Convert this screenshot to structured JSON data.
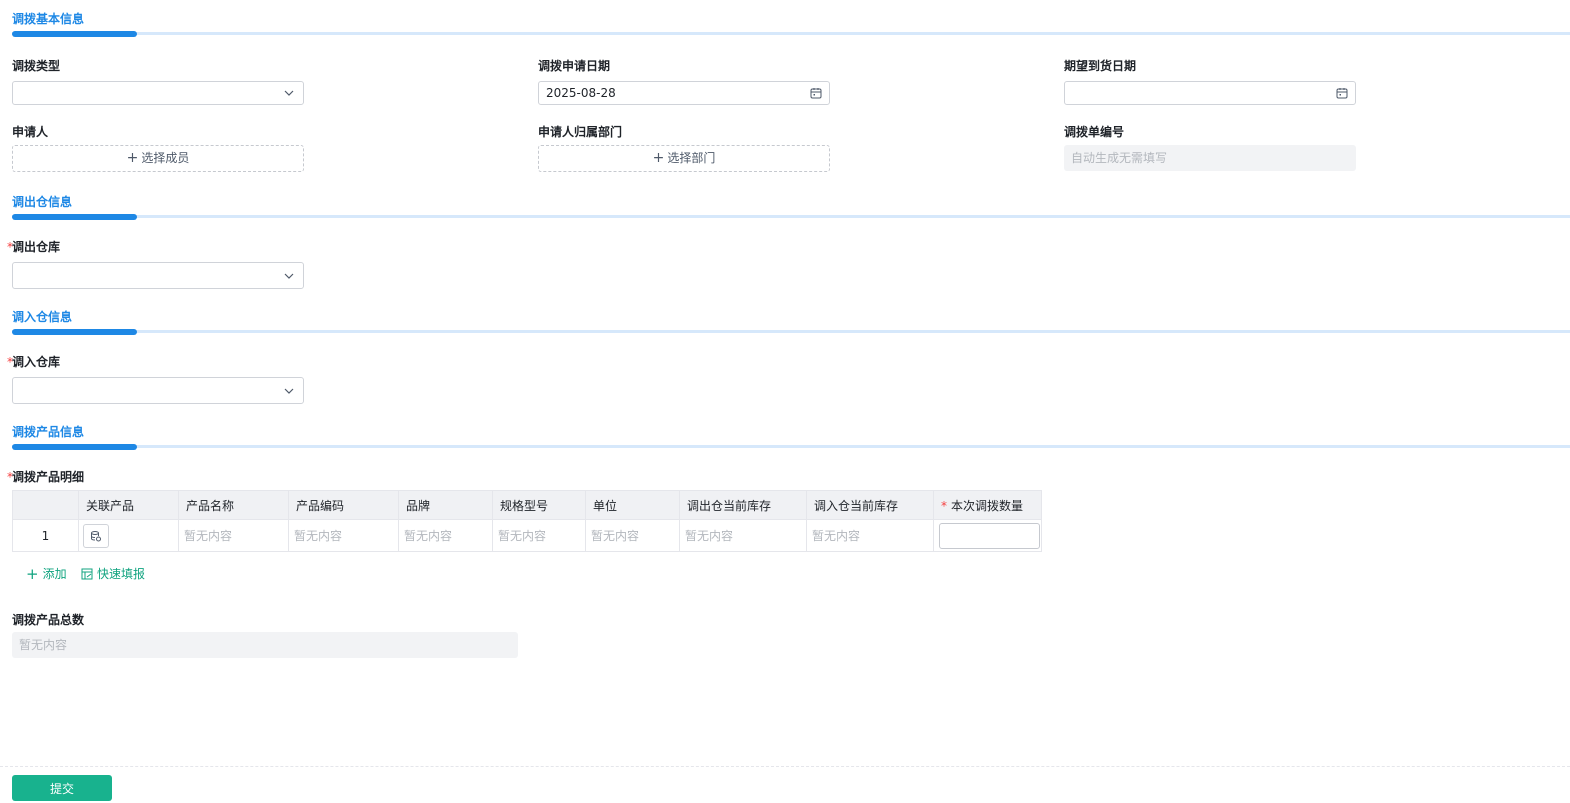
{
  "sections": {
    "basic": "调拨基本信息",
    "out": "调出仓信息",
    "in": "调入仓信息",
    "product": "调拨产品信息"
  },
  "basic": {
    "type_label": "调拨类型",
    "type_value": "",
    "apply_date_label": "调拨申请日期",
    "apply_date_value": "2025-08-28",
    "expect_date_label": "期望到货日期",
    "expect_date_value": "",
    "applicant_label": "申请人",
    "applicant_button": "选择成员",
    "dept_label": "申请人归属部门",
    "dept_button": "选择部门",
    "order_no_label": "调拨单编号",
    "order_no_placeholder": "自动生成无需填写"
  },
  "out": {
    "warehouse_label": "调出仓库",
    "required_mark": "*"
  },
  "in": {
    "warehouse_label": "调入仓库",
    "required_mark": "*"
  },
  "product": {
    "detail_label": "调拨产品明细",
    "required_mark": "*",
    "columns": [
      "",
      "关联产品",
      "产品名称",
      "产品编码",
      "品牌",
      "规格型号",
      "单位",
      "调出仓当前库存",
      "调入仓当前库存",
      "本次调拨数量"
    ],
    "qty_required_mark": "*",
    "rows": [
      {
        "index": "1",
        "name": "暂无内容",
        "code": "暂无内容",
        "brand": "暂无内容",
        "spec": "暂无内容",
        "unit": "暂无内容",
        "out_stock": "暂无内容",
        "in_stock": "暂无内容"
      }
    ],
    "add_label": "添加",
    "quick_fill_label": "快速填报",
    "total_label": "调拨产品总数",
    "total_value": "暂无内容"
  },
  "submit_label": "提交",
  "icons": {
    "caret": "chevron-down-icon",
    "calendar": "calendar-icon",
    "plus": "plus-icon",
    "product_link": "database-icon",
    "quick_fill": "table-edit-icon"
  },
  "colors": {
    "accent": "#1e88e5",
    "submit": "#18b28e",
    "link": "#10a37f",
    "required": "#f53f3f"
  }
}
